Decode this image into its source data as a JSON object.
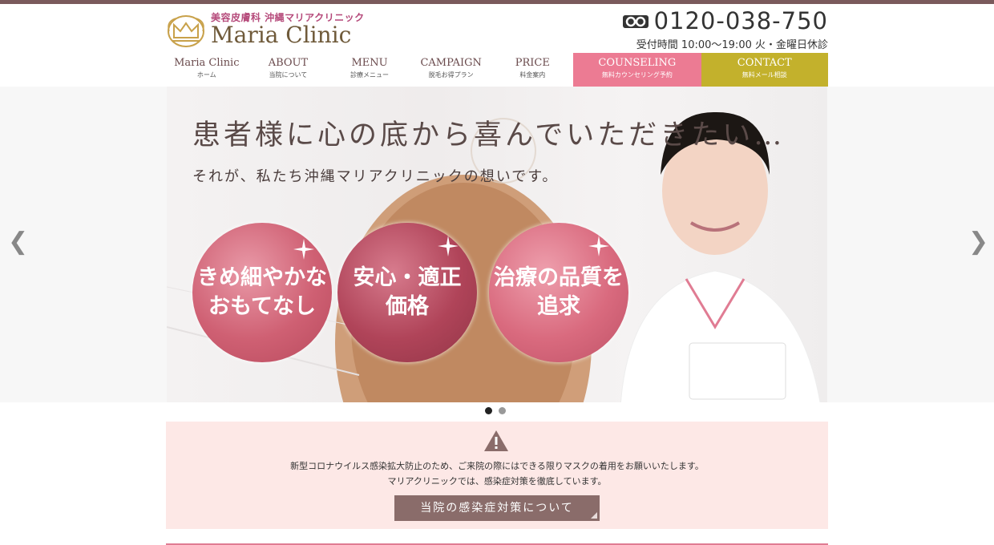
{
  "brand": {
    "subtitle": "美容皮膚科 沖縄マリアクリニック",
    "name": "Maria Clinic"
  },
  "phone": {
    "icon": "free-dial-icon",
    "number": "0120-038-750",
    "hours": "受付時間 10:00〜19:00 火・金曜日休診"
  },
  "nav": {
    "items": [
      {
        "en": "Maria Clinic",
        "jp": "ホーム"
      },
      {
        "en": "ABOUT",
        "jp": "当院について"
      },
      {
        "en": "MENU",
        "jp": "診療メニュー"
      },
      {
        "en": "CAMPAIGN",
        "jp": "脱毛お得プラン"
      },
      {
        "en": "PRICE",
        "jp": "料金案内"
      },
      {
        "en": "COUNSELING",
        "jp": "無料カウンセリング予約"
      },
      {
        "en": "CONTACT",
        "jp": "無料メール相談"
      }
    ]
  },
  "hero": {
    "headline": "患者様に心の底から喜んでいただきたい…",
    "subline": "それが、私たち沖縄マリアクリニックの想いです。",
    "badges": [
      "きめ細やかな\nおもてなし",
      "安心・適正\n価格",
      "治療の品質を\n追求"
    ],
    "prev_arrow": "❮",
    "next_arrow": "❯",
    "slide_count": 2,
    "active_slide": 1
  },
  "notice": {
    "icon": "warning-icon",
    "line1": "新型コロナウイルス感染拡大防止のため、ご来院の際にはできる限りマスクの着用をお願いいたします。",
    "line2": "マリアクリニックでは、感染症対策を徹底しています。",
    "button": "当院の感染症対策について"
  },
  "colors": {
    "counseling": "#ec7b93",
    "contact": "#c3b12c",
    "badge": "#cf6073",
    "notice_bg": "#fde8e6",
    "notice_button": "#8a6c6a",
    "top_stripe": "#7a5a5c"
  }
}
